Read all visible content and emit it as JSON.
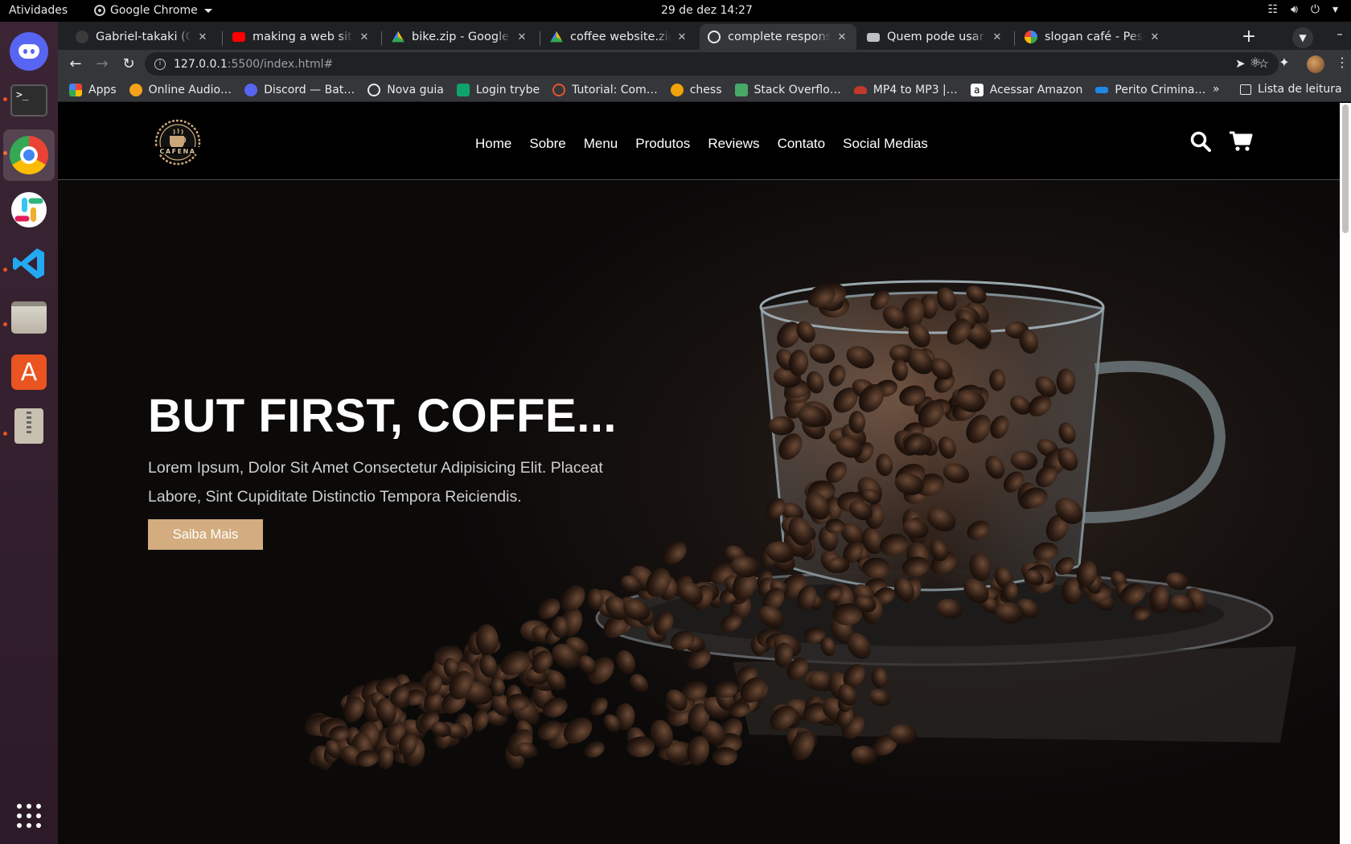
{
  "system_bar": {
    "activities": "Atividades",
    "app_name": "Google Chrome",
    "datetime": "29 de dez  14:27"
  },
  "dock": {
    "apps": [
      "discord",
      "terminal",
      "google-chrome",
      "slack",
      "visual-studio-code",
      "files",
      "ubuntu-software",
      "archive-manager",
      "show-applications"
    ]
  },
  "browser": {
    "tabs": [
      {
        "title": "Gabriel-takaki (Gabriel",
        "icon": "github-icon"
      },
      {
        "title": "making a web site h",
        "icon": "youtube-icon"
      },
      {
        "title": "bike.zip - Google Dr",
        "icon": "google-drive-icon"
      },
      {
        "title": "coffee website.zip -",
        "icon": "google-drive-icon"
      },
      {
        "title": "complete responsive",
        "icon": "globe-icon",
        "active": true
      },
      {
        "title": "Quem pode usar o c",
        "icon": "mail-icon"
      },
      {
        "title": "slogan café - Pesqu",
        "icon": "google-icon"
      }
    ],
    "url_host": "127.0.0.1",
    "url_path": ":5500/index.html#",
    "bookmarks": [
      {
        "label": "Apps",
        "icon": "apps-grid-icon"
      },
      {
        "label": "Online Audio…",
        "icon": "audio-icon"
      },
      {
        "label": "Discord — Bat…",
        "icon": "discord-icon"
      },
      {
        "label": "Nova guia",
        "icon": "globe-icon"
      },
      {
        "label": "Login trybe",
        "icon": "trybe-icon"
      },
      {
        "label": "Tutorial: Com…",
        "icon": "tutorial-icon"
      },
      {
        "label": "chess",
        "icon": "chess-icon"
      },
      {
        "label": "Stack Overflo…",
        "icon": "stackoverflow-icon"
      },
      {
        "label": "MP4 to MP3 |…",
        "icon": "converter-icon"
      },
      {
        "label": "Acessar Amazon",
        "icon": "amazon-icon"
      },
      {
        "label": "Perito Crimina…",
        "icon": "perito-icon"
      }
    ],
    "bookmarks_more": "»",
    "reading_list": "Lista de leitura"
  },
  "site": {
    "logo_text": "CAFENA",
    "nav": [
      "Home",
      "Sobre",
      "Menu",
      "Produtos",
      "Reviews",
      "Contato",
      "Social Medias"
    ],
    "hero": {
      "title": "BUT FIRST, COFFE...",
      "subtitle": "Lorem Ipsum, Dolor Sit Amet Consectetur Adipisicing Elit. Placeat Labore, Sint Cupiditate Distinctio Tempora Reiciendis.",
      "button": "Saiba Mais"
    },
    "accent_color": "#d3ad7f"
  }
}
